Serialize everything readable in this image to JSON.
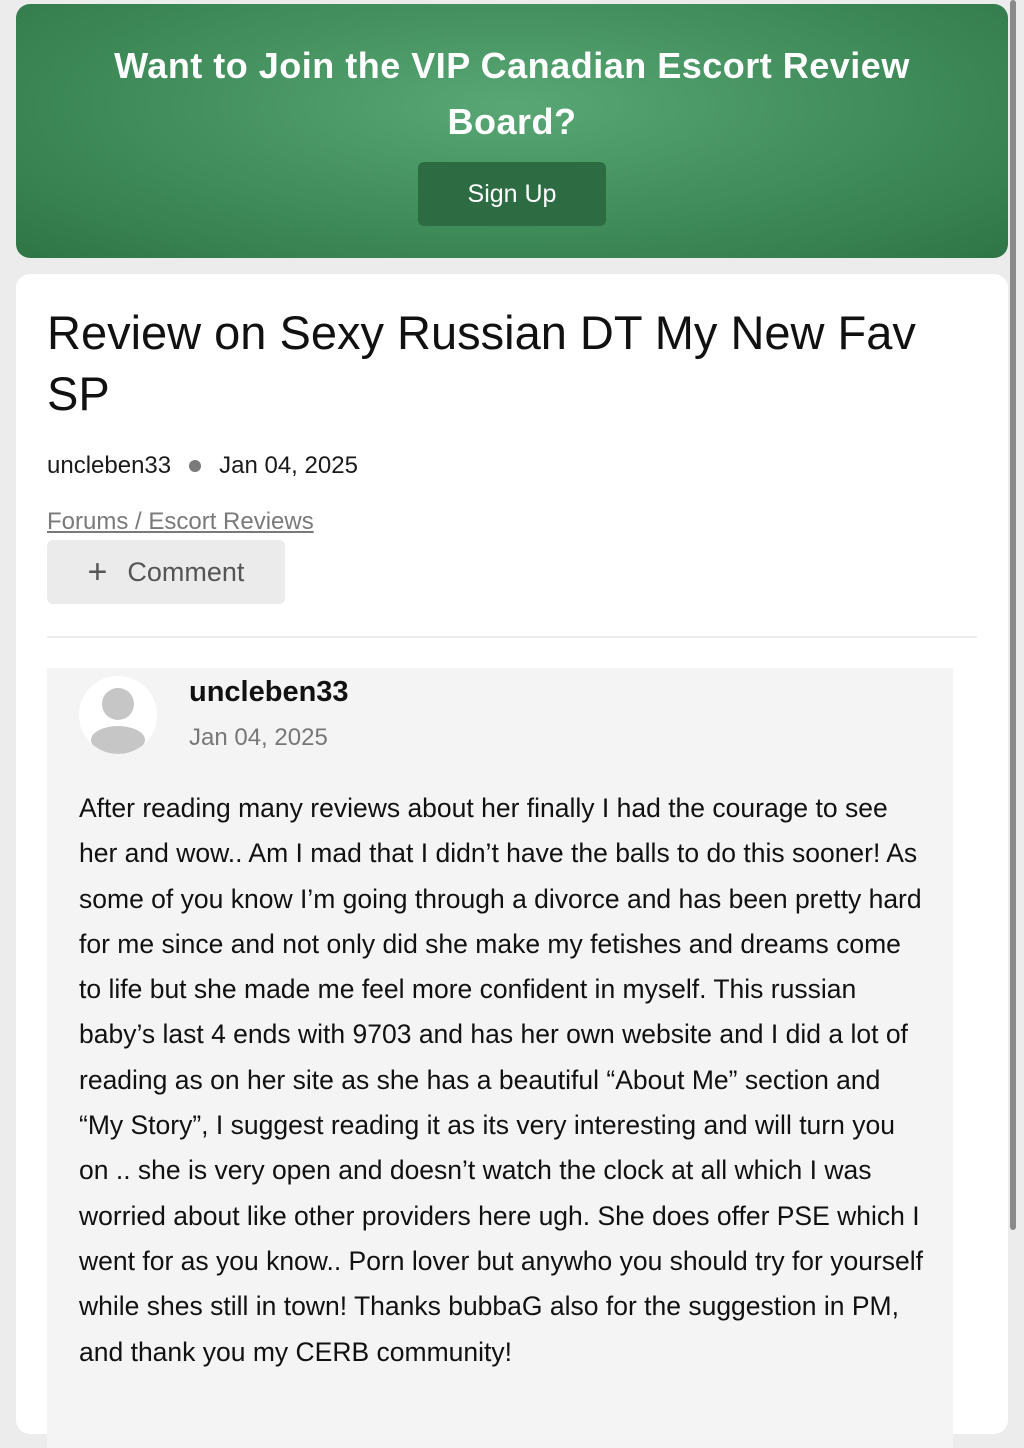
{
  "banner": {
    "title": "Want to Join the VIP Canadian Escort Review Board?",
    "signup_label": "Sign Up",
    "gradient_colors": [
      "#58a774",
      "#2f7546"
    ],
    "button_color": "#2d6b43"
  },
  "post": {
    "title": "Review on Sexy Russian DT My New Fav SP",
    "author": "uncleben33",
    "date": "Jan 04, 2025",
    "breadcrumb": "Forums / Escort Reviews",
    "comment_label": "Comment",
    "comment_icon": "plus-icon"
  },
  "reply": {
    "author": "uncleben33",
    "date": "Jan 04, 2025",
    "avatar_icon": "default-user-avatar-icon",
    "body": "After reading many reviews about her finally I had the courage to see her and wow.. Am I mad that I didn’t have the balls to do this sooner! As some of you know I’m going through a divorce and has been pretty hard for me since and not only did she make my fetishes and dreams come to life but she made me feel more confident in myself. This russian baby’s last 4 ends with 9703 and has her own website and I did a lot of reading as on her site as she has a beautiful “About Me” section and “My Story”, I suggest reading it as its very interesting and will turn you on .. she is very open and doesn’t watch the clock at all which I was worried about like other providers here ugh. She does offer PSE which I went for as you know.. Porn lover but anywho you should try for yourself while shes still in town! Thanks bubbaG also for the suggestion in PM, and thank you my CERB community!"
  }
}
